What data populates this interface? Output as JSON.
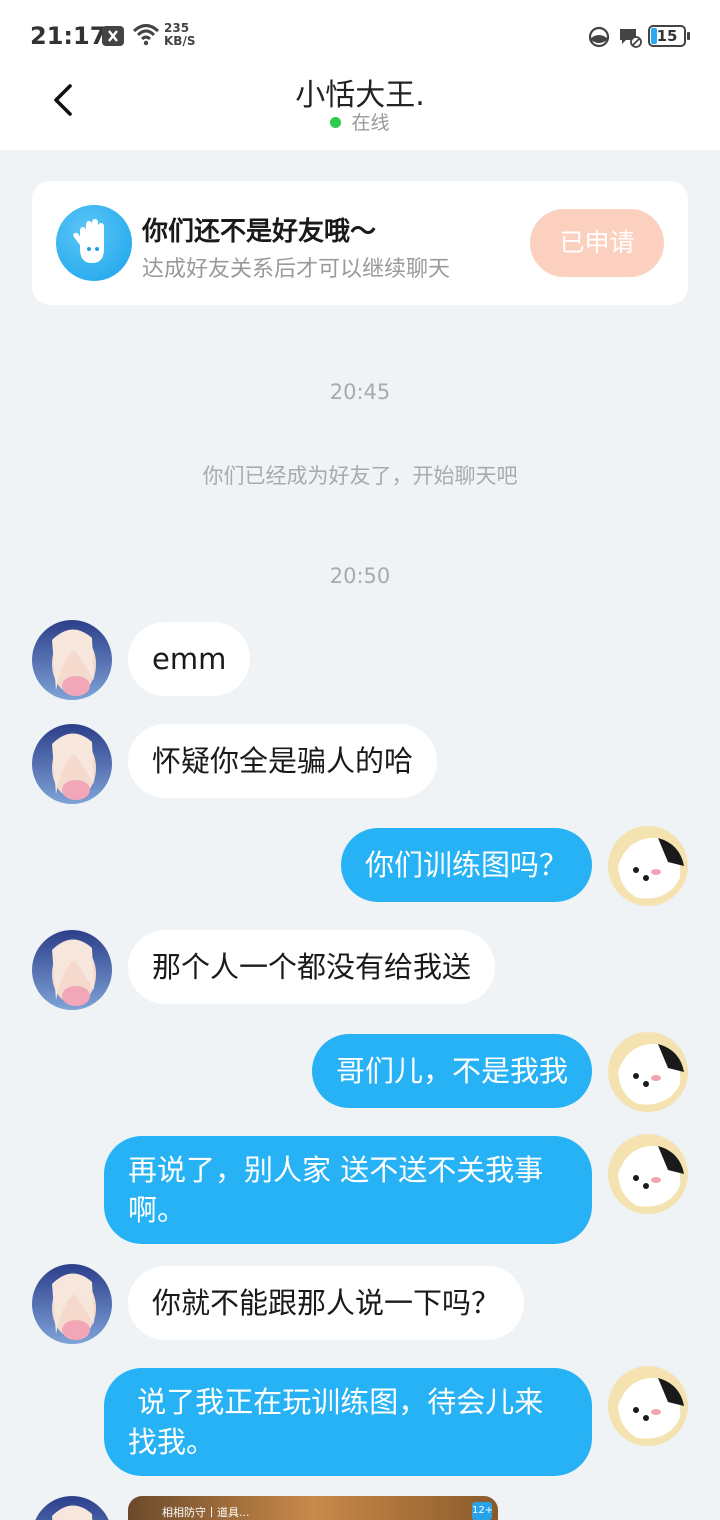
{
  "status_bar": {
    "time": "21:17",
    "net_speed": "235",
    "net_unit": "KB/S",
    "battery": "15"
  },
  "header": {
    "title": "小恬大王.",
    "status": "在线"
  },
  "friend_card": {
    "title": "你们还不是好友哦～",
    "subtitle": "达成好友关系后才可以继续聊天",
    "button": "已申请"
  },
  "system_messages": [
    {
      "text": "20:45"
    },
    {
      "text": "你们已经成为好友了，开始聊天吧"
    },
    {
      "text": "20:50"
    }
  ],
  "messages": [
    {
      "side": "left",
      "text": "emm"
    },
    {
      "side": "left",
      "text": "怀疑你全是骗人的哈"
    },
    {
      "side": "right",
      "text": "你们训练图吗？"
    },
    {
      "side": "left",
      "text": "那个人一个都没有给我送"
    },
    {
      "side": "right",
      "text": "哥们儿，不是我我"
    },
    {
      "side": "right",
      "lines": [
        "再说了，别人家 送不送不关我事",
        "啊。"
      ]
    },
    {
      "side": "left",
      "text": "你就不能跟那人说一下吗？"
    },
    {
      "side": "right",
      "lines": [
        " 说了我正在玩训练图，待会儿来",
        "找我。"
      ]
    }
  ],
  "preview": {
    "caption": "相相防守丨道具...",
    "badge": "12+"
  },
  "colors": {
    "accent_blue": "#27b2f5",
    "online_green": "#2ec84a",
    "applied_button": "#fcd0be"
  }
}
